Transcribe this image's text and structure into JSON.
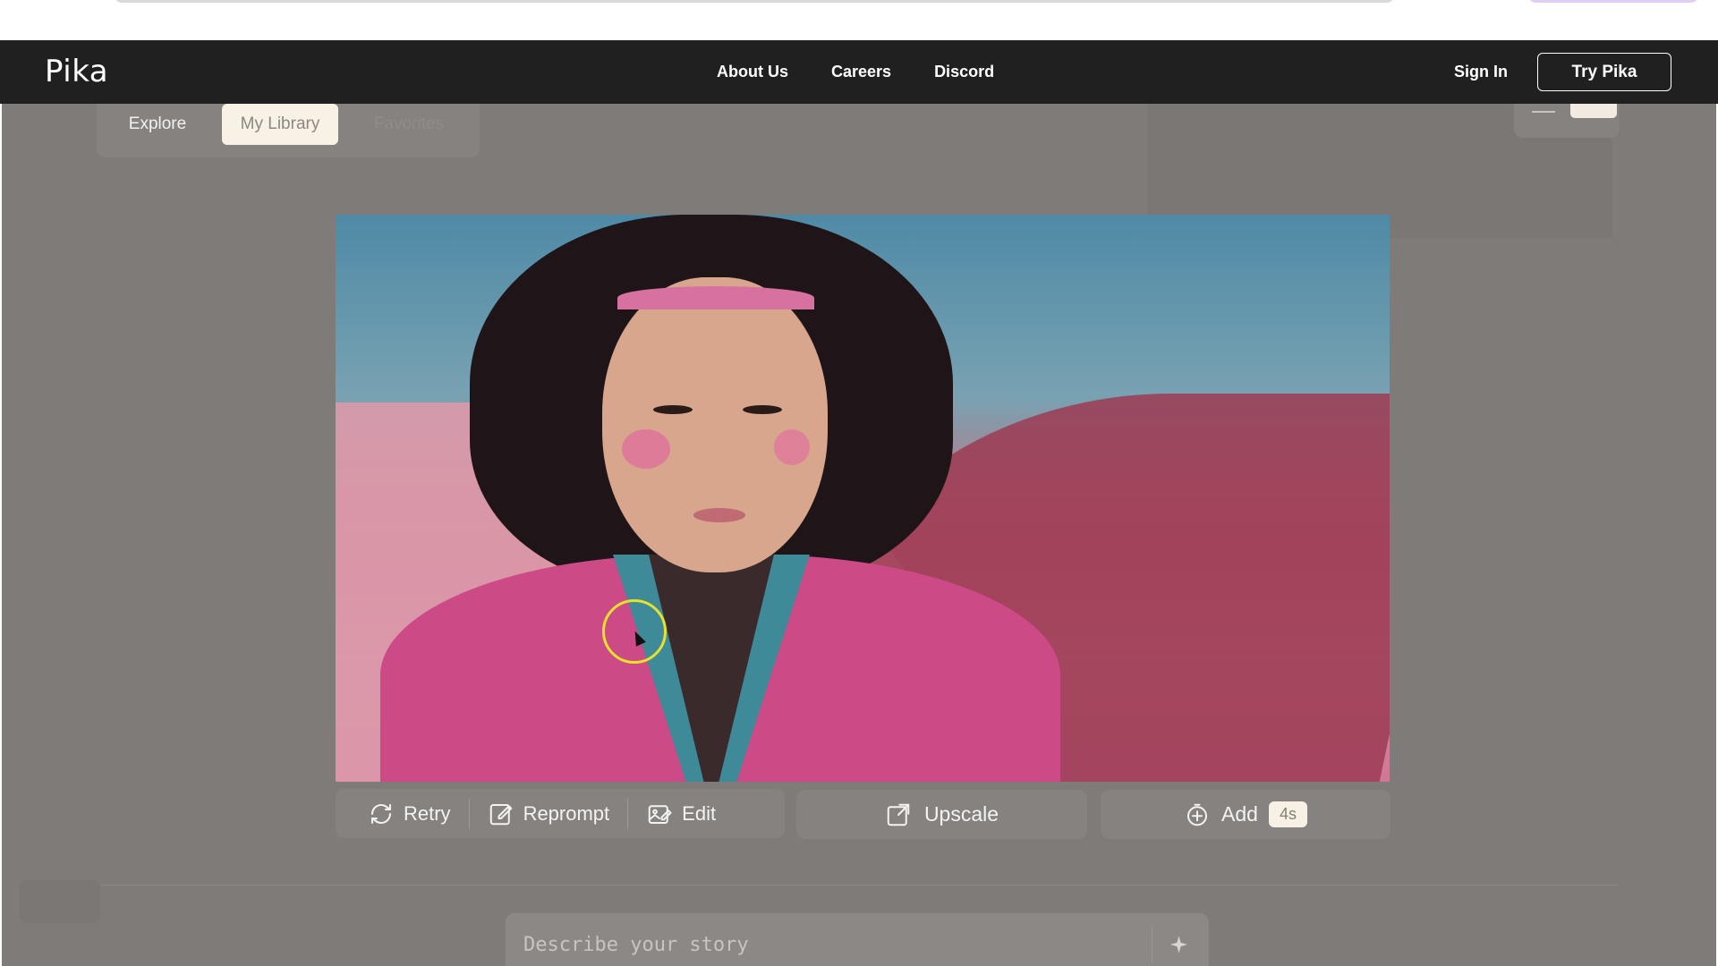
{
  "navbar": {
    "logo": "Pika",
    "links": [
      "About Us",
      "Careers",
      "Discord"
    ],
    "sign_in": "Sign In",
    "try_button": "Try Pika"
  },
  "tabs": {
    "explore": "Explore",
    "library": "My Library",
    "favorites": "Favorites",
    "active": "My Library"
  },
  "video": {
    "icon": "video-frame-image"
  },
  "actions": {
    "retry": "Retry",
    "reprompt": "Reprompt",
    "edit": "Edit",
    "upscale": "Upscale",
    "add": "Add",
    "add_badge": "4s"
  },
  "prompt": {
    "placeholder": "Describe your story"
  },
  "colors": {
    "navbar_bg": "#202020",
    "overlay_bg": "#7e7b78",
    "active_tab_bg": "#f8f1e6",
    "cursor_ring": "#e6e12c"
  }
}
